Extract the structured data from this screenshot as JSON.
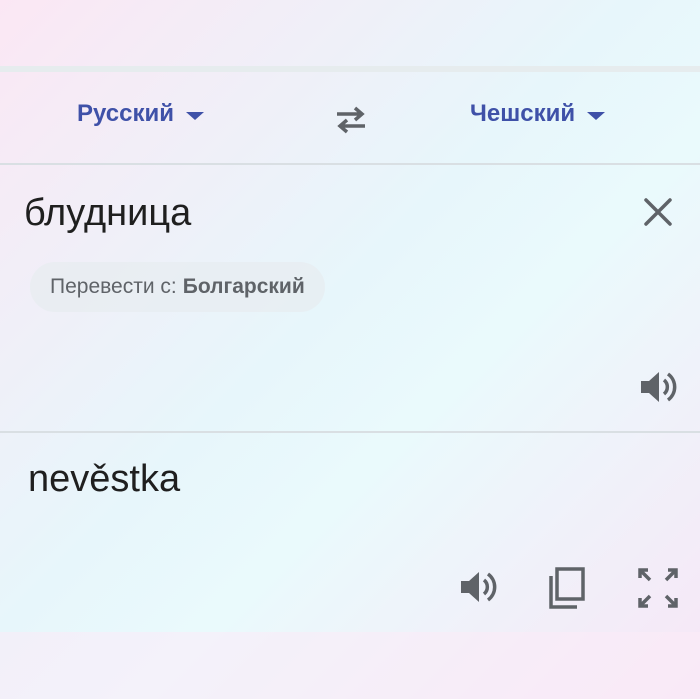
{
  "langbar": {
    "source_lang": "Русский",
    "target_lang": "Чешский"
  },
  "input": {
    "text": "блудница",
    "detect_prefix": "Перевести с:",
    "detect_lang": "Болгарский"
  },
  "output": {
    "text": "nevěstka"
  },
  "icons": {
    "swap": "swap-arrows-icon",
    "clear": "close-icon",
    "speak": "speaker-icon",
    "copy": "copy-icon",
    "fullscreen": "fullscreen-icon"
  },
  "colors": {
    "accent": "#3f51a8",
    "icon": "#5f6368",
    "text": "#1f1f1f"
  }
}
